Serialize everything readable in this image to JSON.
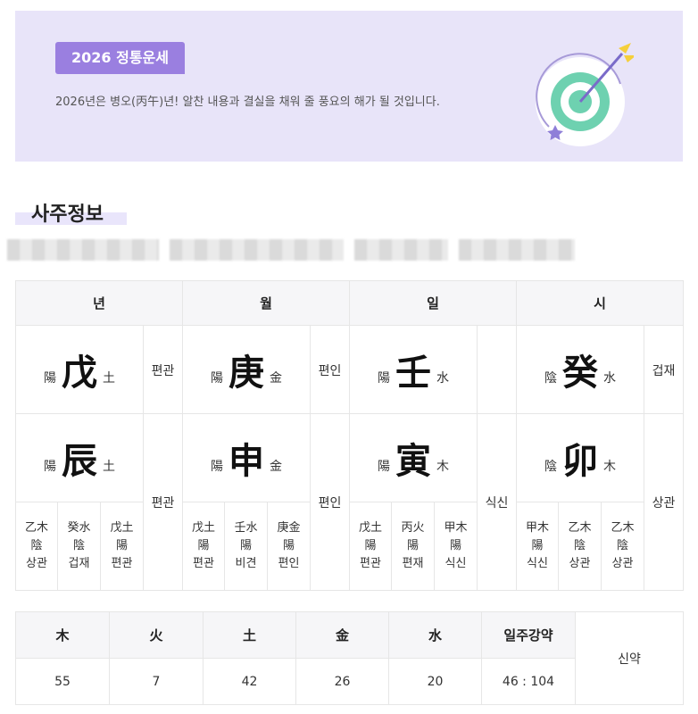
{
  "banner": {
    "badge": "2026 정통운세",
    "description": "2026년은 병오(丙午)년! 알찬 내용과 결실을 채워 줄 풍요의 해가 될 것입니다."
  },
  "section_title": "사주정보",
  "pillars": {
    "headers": [
      "년",
      "월",
      "일",
      "시"
    ],
    "heaven": [
      {
        "yinyang": "陽",
        "char": "戊",
        "element": "土",
        "ten_god": "편관"
      },
      {
        "yinyang": "陽",
        "char": "庚",
        "element": "金",
        "ten_god": "편인"
      },
      {
        "yinyang": "陽",
        "char": "壬",
        "element": "水",
        "ten_god": ""
      },
      {
        "yinyang": "陰",
        "char": "癸",
        "element": "水",
        "ten_god": "겁재"
      }
    ],
    "earth": [
      {
        "yinyang": "陽",
        "char": "辰",
        "element": "土",
        "ten_god": "편관",
        "hidden": [
          {
            "stem": "乙木",
            "yinyang": "陰",
            "god": "상관"
          },
          {
            "stem": "癸水",
            "yinyang": "陰",
            "god": "겁재"
          },
          {
            "stem": "戊土",
            "yinyang": "陽",
            "god": "편관"
          }
        ]
      },
      {
        "yinyang": "陽",
        "char": "申",
        "element": "金",
        "ten_god": "편인",
        "hidden": [
          {
            "stem": "戊土",
            "yinyang": "陽",
            "god": "편관"
          },
          {
            "stem": "壬水",
            "yinyang": "陽",
            "god": "비견"
          },
          {
            "stem": "庚金",
            "yinyang": "陽",
            "god": "편인"
          }
        ]
      },
      {
        "yinyang": "陽",
        "char": "寅",
        "element": "木",
        "ten_god": "식신",
        "hidden": [
          {
            "stem": "戊土",
            "yinyang": "陽",
            "god": "편관"
          },
          {
            "stem": "丙火",
            "yinyang": "陽",
            "god": "편재"
          },
          {
            "stem": "甲木",
            "yinyang": "陽",
            "god": "식신"
          }
        ]
      },
      {
        "yinyang": "陰",
        "char": "卯",
        "element": "木",
        "ten_god": "상관",
        "hidden": [
          {
            "stem": "甲木",
            "yinyang": "陽",
            "god": "식신"
          },
          {
            "stem": "乙木",
            "yinyang": "陰",
            "god": "상관"
          },
          {
            "stem": "乙木",
            "yinyang": "陰",
            "god": "상관"
          }
        ]
      }
    ]
  },
  "elements": {
    "headers": [
      "木",
      "火",
      "土",
      "金",
      "水",
      "일주강약"
    ],
    "values": [
      "55",
      "7",
      "42",
      "26",
      "20",
      "46 : 104"
    ],
    "strength": "신약"
  }
}
